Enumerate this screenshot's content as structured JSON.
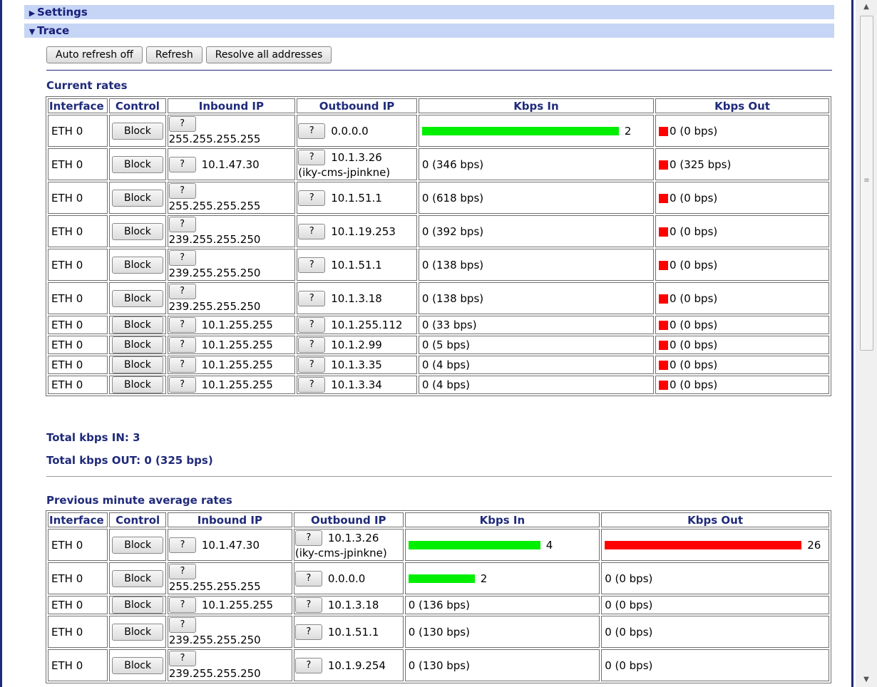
{
  "sections": {
    "settings": {
      "label": "Settings",
      "state": "collapsed"
    },
    "trace": {
      "label": "Trace",
      "state": "expanded"
    }
  },
  "toolbar": {
    "auto_refresh": "Auto refresh off",
    "refresh": "Refresh",
    "resolve": "Resolve all addresses"
  },
  "columns": [
    "Interface",
    "Control",
    "Inbound IP",
    "Outbound IP",
    "Kbps In",
    "Kbps Out"
  ],
  "block_label": "Block",
  "lookup_label": "?",
  "current": {
    "title": "Current rates",
    "rows": [
      {
        "iface": "ETH 0",
        "in_ip": "255.255.255.255",
        "out_ip": "0.0.0.0",
        "out_host": "",
        "kin": "2",
        "kin_bar": 1.0,
        "kout": "0 (0 bps)",
        "kout_bar": 0
      },
      {
        "iface": "ETH 0",
        "in_ip": "10.1.47.30",
        "out_ip": "10.1.3.26",
        "out_host": "(iky-cms-jpinkne)",
        "kin": "0 (346 bps)",
        "kin_bar": 0,
        "kout": "0 (325 bps)",
        "kout_bar": 0
      },
      {
        "iface": "ETH 0",
        "in_ip": "255.255.255.255",
        "out_ip": "10.1.51.1",
        "out_host": "",
        "kin": "0 (618 bps)",
        "kin_bar": 0,
        "kout": "0 (0 bps)",
        "kout_bar": 0
      },
      {
        "iface": "ETH 0",
        "in_ip": "239.255.255.250",
        "out_ip": "10.1.19.253",
        "out_host": "",
        "kin": "0 (392 bps)",
        "kin_bar": 0,
        "kout": "0 (0 bps)",
        "kout_bar": 0
      },
      {
        "iface": "ETH 0",
        "in_ip": "239.255.255.250",
        "out_ip": "10.1.51.1",
        "out_host": "",
        "kin": "0 (138 bps)",
        "kin_bar": 0,
        "kout": "0 (0 bps)",
        "kout_bar": 0
      },
      {
        "iface": "ETH 0",
        "in_ip": "239.255.255.250",
        "out_ip": "10.1.3.18",
        "out_host": "",
        "kin": "0 (138 bps)",
        "kin_bar": 0,
        "kout": "0 (0 bps)",
        "kout_bar": 0
      },
      {
        "iface": "ETH 0",
        "in_ip": "10.1.255.255",
        "out_ip": "10.1.255.112",
        "out_host": "",
        "kin": "0 (33 bps)",
        "kin_bar": 0,
        "kout": "0 (0 bps)",
        "kout_bar": 0
      },
      {
        "iface": "ETH 0",
        "in_ip": "10.1.255.255",
        "out_ip": "10.1.2.99",
        "out_host": "",
        "kin": "0 (5 bps)",
        "kin_bar": 0,
        "kout": "0 (0 bps)",
        "kout_bar": 0
      },
      {
        "iface": "ETH 0",
        "in_ip": "10.1.255.255",
        "out_ip": "10.1.3.35",
        "out_host": "",
        "kin": "0 (4 bps)",
        "kin_bar": 0,
        "kout": "0 (0 bps)",
        "kout_bar": 0
      },
      {
        "iface": "ETH 0",
        "in_ip": "10.1.255.255",
        "out_ip": "10.1.3.34",
        "out_host": "",
        "kin": "0 (4 bps)",
        "kin_bar": 0,
        "kout": "0 (0 bps)",
        "kout_bar": 0
      }
    ],
    "total_in": "Total kbps IN: 3",
    "total_out": "Total kbps OUT: 0 (325 bps)"
  },
  "previous": {
    "title": "Previous minute average rates",
    "rows": [
      {
        "iface": "ETH 0",
        "in_ip": "10.1.47.30",
        "out_ip": "10.1.3.26",
        "out_host": "(iky-cms-jpinkne)",
        "kin": "4",
        "kin_bar": 1.0,
        "kout": "26",
        "kout_bar": 1.0
      },
      {
        "iface": "ETH 0",
        "in_ip": "255.255.255.255",
        "out_ip": "0.0.0.0",
        "out_host": "",
        "kin": "2",
        "kin_bar": 0.5,
        "kout": "0 (0 bps)",
        "kout_bar": 0
      },
      {
        "iface": "ETH 0",
        "in_ip": "10.1.255.255",
        "out_ip": "10.1.3.18",
        "out_host": "",
        "kin": "0 (136 bps)",
        "kin_bar": 0,
        "kout": "0 (0 bps)",
        "kout_bar": 0
      },
      {
        "iface": "ETH 0",
        "in_ip": "239.255.255.250",
        "out_ip": "10.1.51.1",
        "out_host": "",
        "kin": "0 (130 bps)",
        "kin_bar": 0,
        "kout": "0 (0 bps)",
        "kout_bar": 0
      },
      {
        "iface": "ETH 0",
        "in_ip": "239.255.255.250",
        "out_ip": "10.1.9.254",
        "out_host": "",
        "kin": "0 (130 bps)",
        "kin_bar": 0,
        "kout": "0 (0 bps)",
        "kout_bar": 0
      }
    ]
  },
  "colors": {
    "bar_in": "#00ee00",
    "bar_out": "#ff0000",
    "heading": "#1f2a7a",
    "section_bg": "#c6d5f5"
  }
}
